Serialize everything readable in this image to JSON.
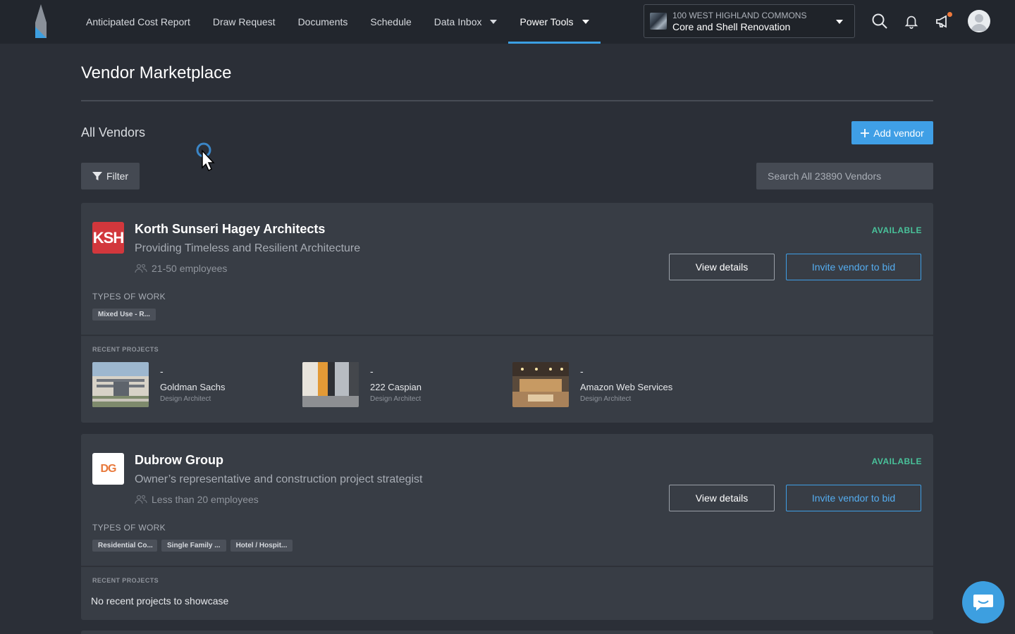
{
  "nav": {
    "links": [
      {
        "label": "Anticipated Cost Report"
      },
      {
        "label": "Draw Request"
      },
      {
        "label": "Documents"
      },
      {
        "label": "Schedule"
      },
      {
        "label": "Data Inbox"
      },
      {
        "label": "Power Tools"
      }
    ],
    "active": "Power Tools",
    "project": {
      "top": "100 WEST HIGHLAND COMMONS",
      "bottom": "Core and Shell Renovation"
    },
    "icons": [
      "search-icon",
      "bell-icon",
      "megaphone-icon",
      "avatar"
    ]
  },
  "page": {
    "title": "Vendor Marketplace",
    "section_title": "All Vendors",
    "add_vendor_label": "Add vendor",
    "filter_label": "Filter",
    "search_placeholder": "Search All 23890 Vendors"
  },
  "labels": {
    "types_of_work": "TYPES OF WORK",
    "recent_projects": "RECENT PROJECTS",
    "view_details": "View details",
    "invite": "Invite vendor to bid"
  },
  "vendors": [
    {
      "logo_text": "KSH",
      "name": "Korth Sunseri Hagey Architects",
      "tagline": "Providing Timeless and Resilient Architecture",
      "employees": "21-50 employees",
      "status": "AVAILABLE",
      "types_of_work": [
        "Mixed Use - R..."
      ],
      "recent_projects": [
        {
          "dash": "-",
          "name": "Goldman Sachs",
          "role": "Design Architect"
        },
        {
          "dash": "-",
          "name": "222 Caspian",
          "role": "Design Architect"
        },
        {
          "dash": "-",
          "name": "Amazon Web Services",
          "role": "Design Architect"
        }
      ]
    },
    {
      "logo_text": "DG",
      "name": "Dubrow Group",
      "tagline": "Owner’s representative and construction project strategist",
      "employees": "Less than 20 employees",
      "status": "AVAILABLE",
      "types_of_work": [
        "Residential Co...",
        "Single Family ...",
        "Hotel / Hospit..."
      ],
      "no_projects_text": "No recent projects to showcase"
    }
  ],
  "colors": {
    "background": "#2b2f37",
    "nav_bg": "#22262d",
    "card_bg": "#383d45",
    "accent": "#3f9fe6",
    "available": "#49c29a",
    "ksh_red": "#d2373c",
    "dg_orange": "#e8783a"
  }
}
